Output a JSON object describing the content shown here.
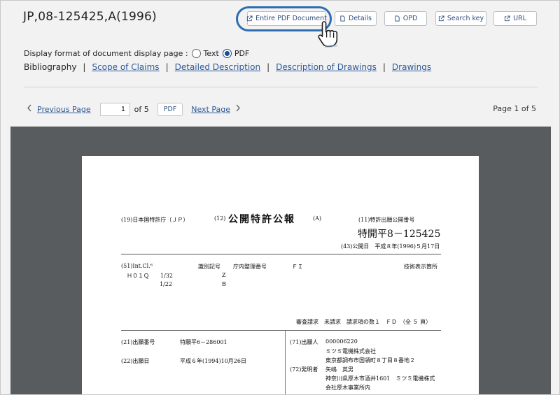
{
  "document": {
    "title": "JP,08-125425,A(1996)"
  },
  "toolbar": {
    "entire_pdf": "Entire PDF Document",
    "details": "Details",
    "opd": "OPD",
    "search_key": "Search key",
    "url": "URL"
  },
  "format": {
    "prefix": "Display format of document display page :",
    "text_label": "Text",
    "pdf_label": "PDF",
    "selected": "PDF"
  },
  "sections": {
    "current": "Bibliography",
    "scope_of_claims": "Scope of Claims",
    "detailed_description": "Detailed Description",
    "description_of_drawings": "Description of Drawings",
    "drawings": "Drawings",
    "separator": "|"
  },
  "pager": {
    "previous": "Previous Page",
    "current_page": "1",
    "of_text": "of 5",
    "pdf_button": "PDF",
    "next": "Next Page",
    "status": "Page 1 of 5"
  },
  "paper": {
    "office": "(19)日本国特許庁（ＪＰ）",
    "kind_code": "(12)",
    "kind_title": "公開特許公報",
    "kind_suffix": "(A)",
    "pub_no_label": "(11)特許出願公開番号",
    "pub_no": "特開平8－125425",
    "pub_date": "(43)公開日　平成８年(1996)５月17日",
    "int_cl": "(51)Int.Cl.⁶",
    "id_sym": "識別記号",
    "office_ref": "庁内整理番号",
    "fi": "ＦＩ",
    "tech_field": "技術表示箇所",
    "class_main": "Ｈ０１Ｑ　　1/32",
    "class_sub": "1/22",
    "sym_z": "Z",
    "sym_b": "B",
    "exam_line": "審査請求　未請求　請求項の数１　ＦＤ　（全 ５ 頁）",
    "app_no_label": "(21)出願番号",
    "app_no": "特願平6－286001",
    "app_date_label": "(22)出願日",
    "app_date": "平成６年(1994)10月26日",
    "applicant_label": "(71)出願人",
    "applicant_id": "000006220",
    "applicant_name": "ミツミ電機株式会社",
    "applicant_addr": "東京都調布市国領町８丁目８番地２",
    "inventor_label": "(72)発明者",
    "inventor_name": "矢嶋　英男",
    "inventor_addr1": "神奈川県厚木市酒井1601　ミツミ電機株式",
    "inventor_addr2": "会社厚木事業所内"
  }
}
